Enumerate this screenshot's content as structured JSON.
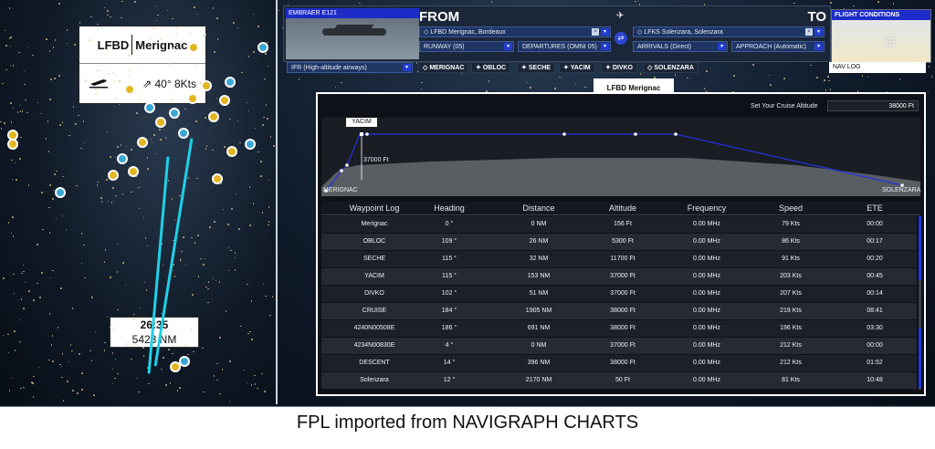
{
  "caption": "FPL imported from NAVIGRAPH CHARTS",
  "airport_card": {
    "code": "LFBD",
    "name": "Merignac",
    "plane_icon": "airplane-takeoff-icon",
    "wind": "40° 8Kts"
  },
  "time_card": {
    "time": "26:35",
    "distance": "5423 NM"
  },
  "aircraft": {
    "name": "EMBRAER E121"
  },
  "from": {
    "label": "FROM",
    "airport": "LFBD Merignac, Bordeaux",
    "runway": "RUNWAY (05)",
    "departure": "DEPARTURES (OMNI 05)"
  },
  "to": {
    "label": "TO",
    "airport": "LFKS Solenzara, Solenzara",
    "arrival": "ARRIVALS (Direct)",
    "approach": "APPROACH (Automatic)"
  },
  "flight_conditions": {
    "label": "FLIGHT CONDITIONS",
    "icon": "sun-icon"
  },
  "route_type": "IFR (High-altitude airways)",
  "waypoint_chips": [
    "MERIGNAC",
    "OBLOC",
    "SECHE",
    "YACIM",
    "DIVKO",
    "SOLENZARA"
  ],
  "nav_log_button": "NAV LOG",
  "lfbd_tag": "LFBD Merignac",
  "cruise": {
    "label": "Set Your Cruise Altitude",
    "value": "38000 Ft"
  },
  "profile": {
    "start": "MERIGNAC",
    "end": "SOLENZARA",
    "tag": "YACIM",
    "alt_label": "37000 Ft"
  },
  "table": {
    "headers": [
      "Waypoint Log",
      "Heading",
      "Distance",
      "Altitude",
      "Frequency",
      "Speed",
      "ETE"
    ],
    "rows": [
      [
        "Merignac",
        "0 °",
        "0 NM",
        "156 Ft",
        "0.00 MHz",
        "79 Kts",
        "00:00"
      ],
      [
        "OBLOC",
        "109 °",
        "26 NM",
        "5300 Ft",
        "0.00 MHz",
        "86 Kts",
        "00:17"
      ],
      [
        "SECHE",
        "115 °",
        "32 NM",
        "11700 Ft",
        "0.00 MHz",
        "91 Kts",
        "00:20"
      ],
      [
        "YACIM",
        "115 °",
        "153 NM",
        "37000 Ft",
        "0.00 MHz",
        "203 Kts",
        "00:45"
      ],
      [
        "DIVKO",
        "102 °",
        "51 NM",
        "37000 Ft",
        "0.00 MHz",
        "207 Kts",
        "00:14"
      ],
      [
        "CRUISE",
        "184 °",
        "1905 NM",
        "38000 Ft",
        "0.00 MHz",
        "219 Kts",
        "08:41"
      ],
      [
        "4240N00508E",
        "186 °",
        "691 NM",
        "38000 Ft",
        "0.00 MHz",
        "196 Kts",
        "03:30"
      ],
      [
        "4234N00830E",
        "4 °",
        "0 NM",
        "37000 Ft",
        "0.00 MHz",
        "212 Kts",
        "00:00"
      ],
      [
        "DESCENT",
        "14 °",
        "396 NM",
        "38000 Ft",
        "0.00 MHz",
        "212 Kts",
        "01:52"
      ],
      [
        "Solenzara",
        "12 °",
        "2170 NM",
        "50 Ft",
        "0.00 MHz",
        "81 Kts",
        "10:48"
      ]
    ]
  }
}
